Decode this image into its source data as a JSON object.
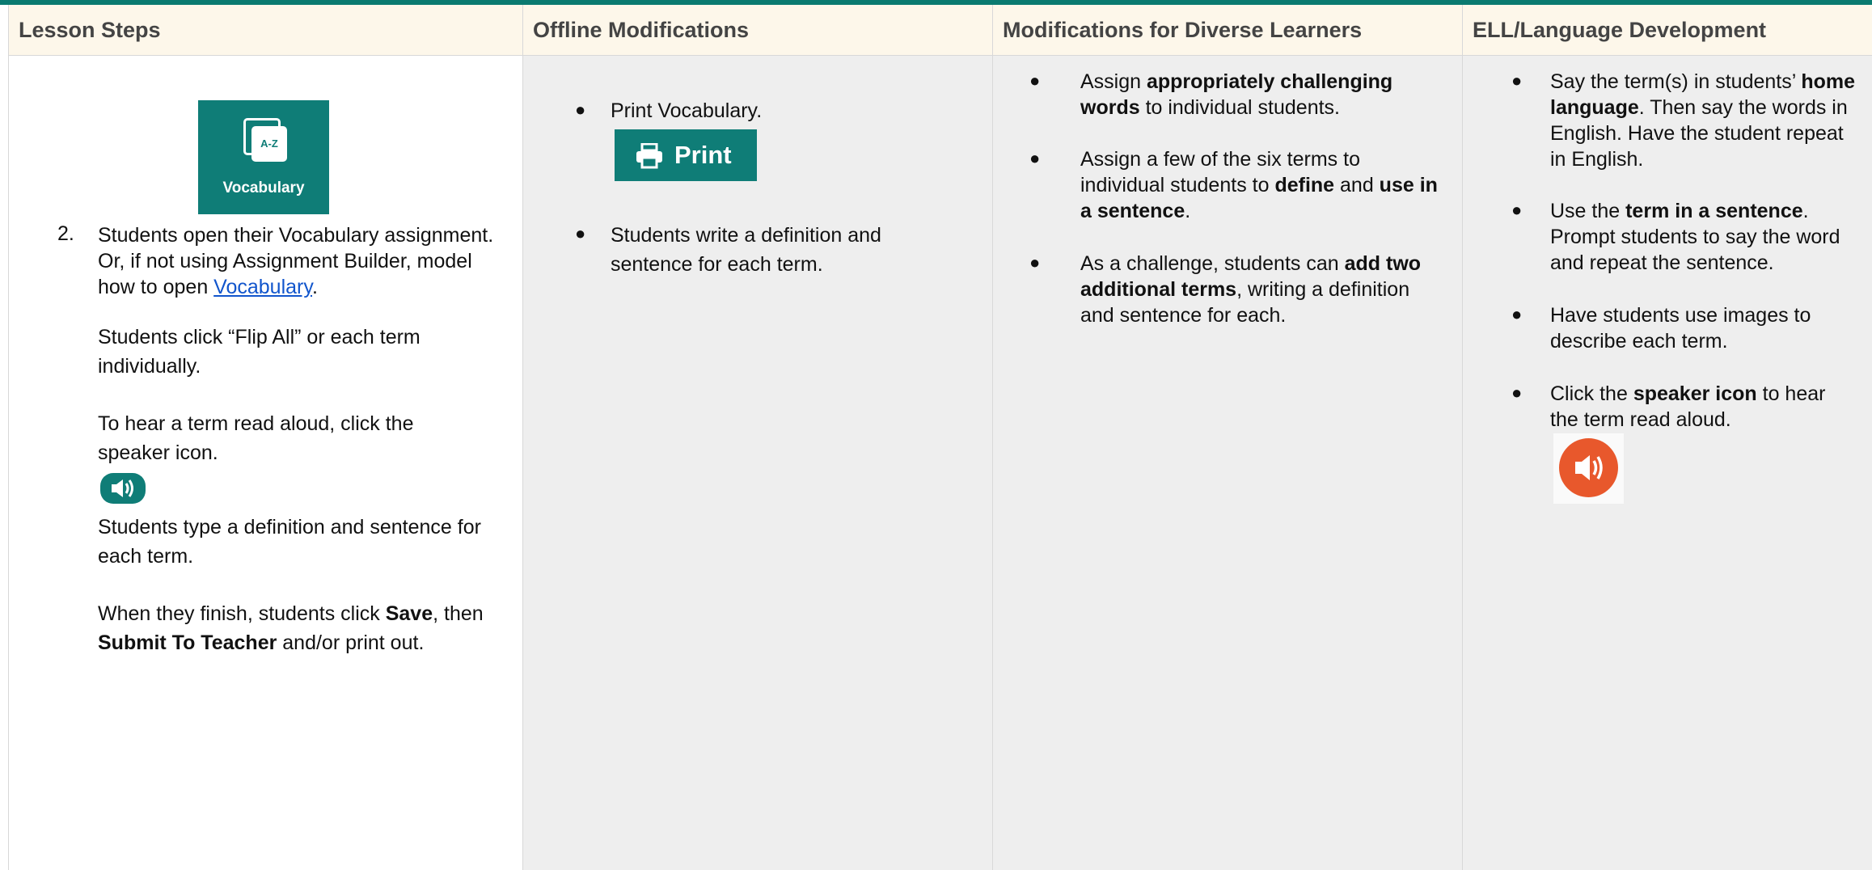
{
  "columns": [
    "Lesson Steps",
    "Offline Modifications",
    "Modifications for Diverse Learners",
    "ELL/Language Development"
  ],
  "lesson_steps": {
    "tile_badge": "A-Z",
    "tile_label": "Vocabulary",
    "step_number": "2.",
    "step_text_before_link": "Students open their Vocabulary assignment. Or, if not using Assignment Builder, model how to open ",
    "step_link": "Vocabulary",
    "step_text_after_link": ".",
    "flip_text": "Students click “Flip All” or each term individually.",
    "hear_text": "To hear a term read aloud, click the speaker icon.",
    "type_text": "Students type a definition and sentence for each term.",
    "finish_prefix": "When they finish, students click ",
    "finish_save": "Save",
    "finish_then": ", then ",
    "finish_submit": "Submit To Teacher",
    "finish_suffix": " and/or print out."
  },
  "offline": {
    "bullet1": "Print Vocabulary.",
    "print_button": "Print",
    "bullet2": "Students write a definition and sentence for each term."
  },
  "diverse": {
    "b1_pre": "Assign ",
    "b1_bold": "appropriately challenging words",
    "b1_post": " to individual students.",
    "b2_pre": "Assign a few of the six terms to individual students to ",
    "b2_bold1": "define",
    "b2_mid": " and ",
    "b2_bold2": "use in a sentence",
    "b2_post": ".",
    "b3_pre": "As a challenge, students can ",
    "b3_bold": "add two additional terms",
    "b3_post": ", writing a definition and sentence for each."
  },
  "ell": {
    "b1_pre": "Say the term(s) in students’ ",
    "b1_bold": "home language",
    "b1_post": ". Then say the words in English. Have the student repeat in English.",
    "b2_pre": "Use the ",
    "b2_bold": "term in a sentence",
    "b2_post": ". Prompt students to say the word and repeat the sentence.",
    "b3": "Have students use images to describe each term.",
    "b4_pre": "Click the ",
    "b4_bold": "speaker icon",
    "b4_post": " to hear the term read aloud."
  },
  "bullet_glyph": "●",
  "icons": [
    "vocabulary-cards-icon",
    "speaker-icon",
    "print-icon"
  ],
  "colors": {
    "accent_teal": "#0f7d77",
    "header_bg": "#fdf7ea",
    "speaker_orange": "#e8582c",
    "link": "#1155cc"
  }
}
